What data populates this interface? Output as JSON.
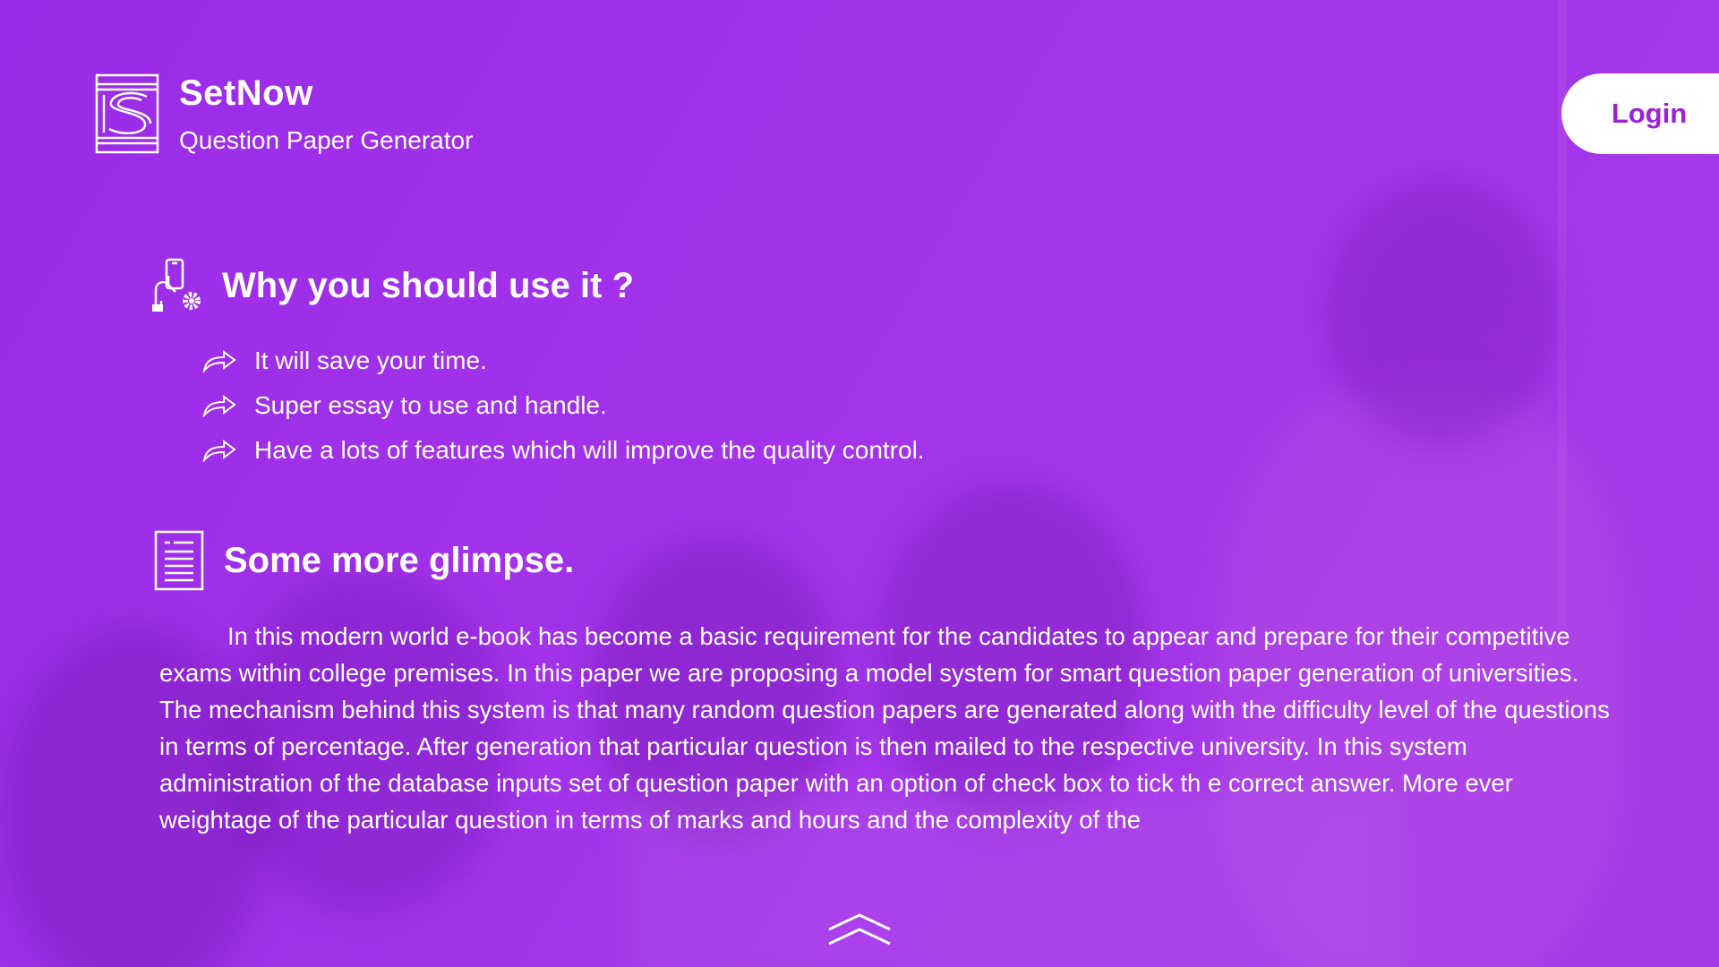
{
  "brand": {
    "name": "SetNow",
    "tagline": "Question Paper Generator",
    "logo_icon": "setnow-s-logo-icon"
  },
  "header": {
    "login_label": "Login"
  },
  "why_section": {
    "title": "Why you should use it ?",
    "icon": "hand-phone-gear-icon",
    "items": [
      "It will save your time.",
      "Super essay to use and handle.",
      "Have a lots of features which will improve the quality control."
    ],
    "item_icon": "share-arrow-icon"
  },
  "glimpse_section": {
    "title": "Some more glimpse.",
    "icon": "document-lines-icon",
    "paragraph": "In this modern world e-book has become a basic requirement for the candidates to appear and prepare for their competitive exams within college premises. In this paper we are proposing a model system for smart question paper generation of universities. The mechanism behind this system is that many random question papers are generated along with the difficulty level of the questions in terms of percentage. After generation that particular question is then mailed to the respective university. In this system administration of the database inputs set of question paper with an option of check box to tick th e correct answer. More ever weightage of the particular question in terms of marks and hours and the complexity of the"
  },
  "footer": {
    "scroll_icon": "double-chevron-up-icon"
  },
  "colors": {
    "background": "#a333ea",
    "login_text": "#9a22d8",
    "text": "#ffffff"
  }
}
